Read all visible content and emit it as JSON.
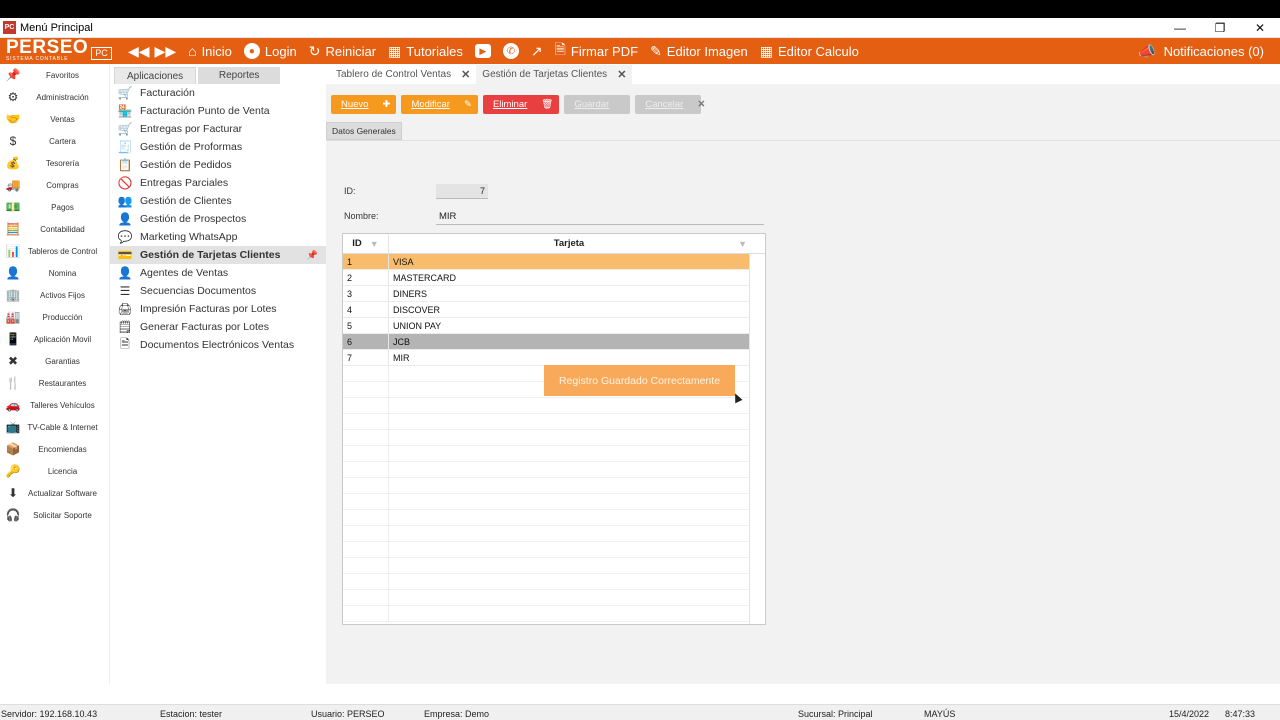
{
  "window": {
    "title": "Menú Principal",
    "app_icon_text": "PC"
  },
  "brand": {
    "name": "PERSEO",
    "subtitle": "SISTEMA CONTABLE",
    "badge": "PC"
  },
  "toolbar": {
    "items": [
      {
        "icon": "house-icon",
        "label": "Inicio"
      },
      {
        "icon": "user-icon",
        "label": "Login"
      },
      {
        "icon": "refresh-icon",
        "label": "Reiniciar"
      },
      {
        "icon": "tutorial-icon",
        "label": "Tutoriales"
      },
      {
        "icon": "youtube-icon",
        "label": ""
      },
      {
        "icon": "whatsapp-icon",
        "label": ""
      },
      {
        "icon": "chart-icon",
        "label": ""
      },
      {
        "icon": "pdf-icon",
        "label": "Firmar PDF"
      },
      {
        "icon": "image-edit-icon",
        "label": "Editor Imagen"
      },
      {
        "icon": "excel-icon",
        "label": "Editor Calculo"
      }
    ],
    "notifications": "Notificaciones (0)"
  },
  "leftnav": {
    "items": [
      {
        "icon": "pin-icon",
        "glyph": "📌",
        "label": "Favoritos"
      },
      {
        "icon": "admin-icon",
        "glyph": "⚙",
        "label": "Administración"
      },
      {
        "icon": "sales-icon",
        "glyph": "🤝",
        "label": "Ventas"
      },
      {
        "icon": "portfolio-icon",
        "glyph": "$",
        "label": "Cartera"
      },
      {
        "icon": "treasury-icon",
        "glyph": "💰",
        "label": "Tesorería"
      },
      {
        "icon": "truck-icon",
        "glyph": "🚚",
        "label": "Compras"
      },
      {
        "icon": "payments-icon",
        "glyph": "💵",
        "label": "Pagos"
      },
      {
        "icon": "accounting-icon",
        "glyph": "🧮",
        "label": "Contabilidad"
      },
      {
        "icon": "dashboard-icon",
        "glyph": "📊",
        "label": "Tableros de Control"
      },
      {
        "icon": "payroll-icon",
        "glyph": "👤",
        "label": "Nomina"
      },
      {
        "icon": "assets-icon",
        "glyph": "🏢",
        "label": "Activos Fijos"
      },
      {
        "icon": "production-icon",
        "glyph": "🏭",
        "label": "Producción"
      },
      {
        "icon": "mobile-icon",
        "glyph": "📱",
        "label": "Aplicación Movil"
      },
      {
        "icon": "tools-icon",
        "glyph": "✖",
        "label": "Garantias"
      },
      {
        "icon": "restaurant-icon",
        "glyph": "🍴",
        "label": "Restaurantes"
      },
      {
        "icon": "garage-icon",
        "glyph": "🚗",
        "label": "Talleres Vehículos"
      },
      {
        "icon": "tv-icon",
        "glyph": "📺",
        "label": "TV-Cable & Internet"
      },
      {
        "icon": "parcel-icon",
        "glyph": "📦",
        "label": "Encomiendas"
      },
      {
        "icon": "license-icon",
        "glyph": "🔑",
        "label": "Licencia"
      },
      {
        "icon": "update-icon",
        "glyph": "⬇",
        "label": "Actualizar Software"
      },
      {
        "icon": "support-icon",
        "glyph": "🎧",
        "label": "Solicitar Soporte"
      }
    ]
  },
  "apps": {
    "tabs": [
      "Aplicaciones",
      "Reportes"
    ],
    "items": [
      {
        "icon": "cart-icon",
        "glyph": "🛒",
        "label": "Facturación"
      },
      {
        "icon": "pos-icon",
        "glyph": "🏪",
        "label": "Facturación Punto de Venta"
      },
      {
        "icon": "delivery-icon",
        "glyph": "🛒",
        "label": "Entregas por Facturar"
      },
      {
        "icon": "proforma-icon",
        "glyph": "🧾",
        "label": "Gestión de Proformas"
      },
      {
        "icon": "orders-icon",
        "glyph": "📋",
        "label": "Gestión de Pedidos"
      },
      {
        "icon": "partial-delivery-icon",
        "glyph": "🚫",
        "label": "Entregas Parciales"
      },
      {
        "icon": "clients-icon",
        "glyph": "👥",
        "label": "Gestión de Clientes"
      },
      {
        "icon": "prospects-icon",
        "glyph": "👤",
        "label": "Gestión de Prospectos"
      },
      {
        "icon": "whatsapp-icon",
        "glyph": "💬",
        "label": "Marketing WhatsApp"
      },
      {
        "icon": "card-icon",
        "glyph": "💳",
        "label": "Gestión de Tarjetas Clientes"
      },
      {
        "icon": "agents-icon",
        "glyph": "👤",
        "label": "Agentes de Ventas"
      },
      {
        "icon": "sequence-icon",
        "glyph": "☰",
        "label": "Secuencias Documentos"
      },
      {
        "icon": "printer-icon",
        "glyph": "🖨",
        "label": "Impresión Facturas por Lotes"
      },
      {
        "icon": "batch-invoice-icon",
        "glyph": "🗒",
        "label": "Generar Facturas por Lotes"
      },
      {
        "icon": "electronic-docs-icon",
        "glyph": "🗎",
        "label": "Documentos Electrónicos Ventas"
      }
    ]
  },
  "doc_tabs": [
    {
      "label": "Tablero de Control Ventas"
    },
    {
      "label": "Gestión de Tarjetas Clientes"
    }
  ],
  "actions": {
    "nuevo": "Nuevo",
    "modificar": "Modificar",
    "eliminar": "Eliminar",
    "guardar": "Guardar",
    "cancelar": "Cancelar"
  },
  "sub_tab": "Datos Generales",
  "form": {
    "id_label": "ID:",
    "id_value": "7",
    "name_label": "Nombre:",
    "name_value": "MIR"
  },
  "grid": {
    "col_id": "ID",
    "col_name": "Tarjeta",
    "rows": [
      {
        "id": "1",
        "name": "VISA"
      },
      {
        "id": "2",
        "name": "MASTERCARD"
      },
      {
        "id": "3",
        "name": "DINERS"
      },
      {
        "id": "4",
        "name": "DISCOVER"
      },
      {
        "id": "5",
        "name": "UNION PAY"
      },
      {
        "id": "6",
        "name": "JCB"
      },
      {
        "id": "7",
        "name": "MIR"
      }
    ]
  },
  "toast": "Registro Guardado Correctamente",
  "status": {
    "servidor": "Servidor: 192.168.10.43",
    "estacion": "Estacion: tester",
    "usuario": "Usuario: PERSEO",
    "empresa": "Empresa: Demo",
    "sucursal": "Sucursal: Principal",
    "mayus": "MAYÚS",
    "fecha": "15/4/2022",
    "hora": "8:47:33"
  },
  "colors": {
    "brand": "#e45f12",
    "button_orange": "#f59a1e",
    "button_red": "#e84040",
    "row_selected": "#f8bc6c"
  }
}
